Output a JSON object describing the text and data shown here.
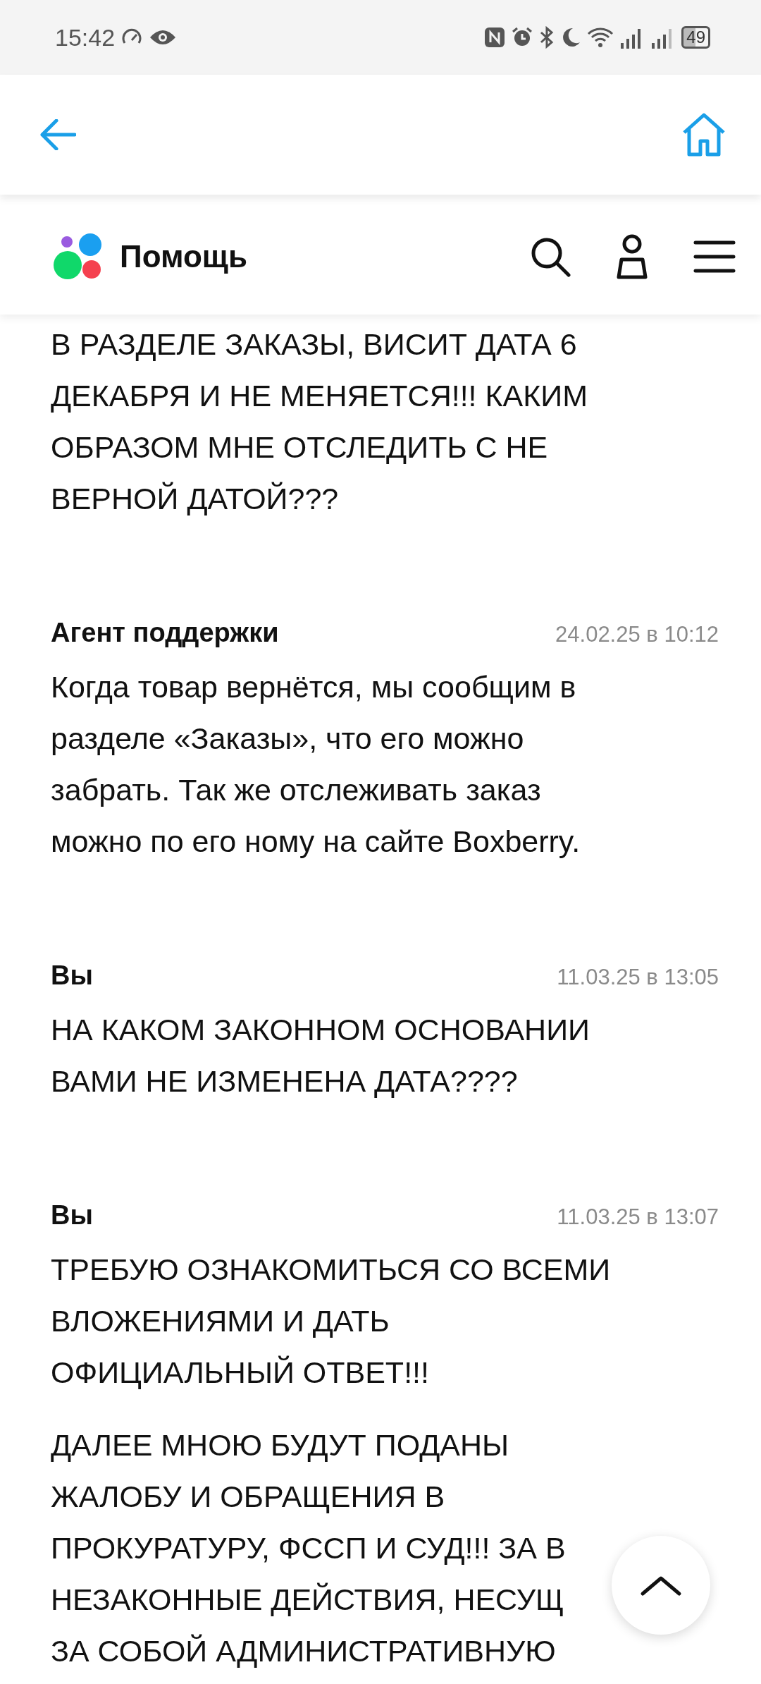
{
  "status_bar": {
    "time": "15:42",
    "battery": "49"
  },
  "header": {
    "title": "Помощь"
  },
  "messages": [
    {
      "paragraphs": [
        {
          "lines": [
            "В РАЗДЕЛЕ ЗАКАЗЫ, ВИСИТ ДАТА 6",
            "ДЕКАБРЯ И НЕ МЕНЯЕТСЯ!!! КАКИМ",
            "ОБРАЗОМ МНЕ ОТСЛЕДИТЬ С НЕ",
            "ВЕРНОЙ ДАТОЙ???"
          ]
        }
      ]
    },
    {
      "author": "Агент поддержки",
      "date": "24.02.25 в 10:12",
      "paragraphs": [
        {
          "lines": [
            "Когда товар вернётся, мы сообщим в",
            "разделе «Заказы», что его можно",
            "забрать. Так же отслеживать заказ",
            "можно по его ному на сайте Boxberry."
          ]
        }
      ]
    },
    {
      "author": "Вы",
      "date": "11.03.25 в 13:05",
      "paragraphs": [
        {
          "lines": [
            "НА КАКОМ ЗАКОННОМ ОСНОВАНИИ",
            "ВАМИ НЕ ИЗМЕНЕНА ДАТА????"
          ]
        }
      ]
    },
    {
      "author": "Вы",
      "date": "11.03.25 в 13:07",
      "paragraphs": [
        {
          "lines": [
            "ТРЕБУЮ ОЗНАКОМИТЬСЯ СО ВСЕМИ",
            "ВЛОЖЕНИЯМИ И ДАТЬ",
            "ОФИЦИАЛЬНЫЙ ОТВЕТ!!!"
          ]
        },
        {
          "lines": [
            "ДАЛЕЕ МНОЮ БУДУТ ПОДАНЫ",
            "ЖАЛОБУ И ОБРАЩЕНИЯ В",
            "ПРОКУРАТУРУ, ФССП И СУД!!! ЗА В",
            "НЕЗАКОННЫЕ ДЕЙСТВИЯ, НЕСУЩ",
            "ЗА СОБОЙ АДМИНИСТРАТИВНУЮ"
          ]
        }
      ]
    }
  ]
}
